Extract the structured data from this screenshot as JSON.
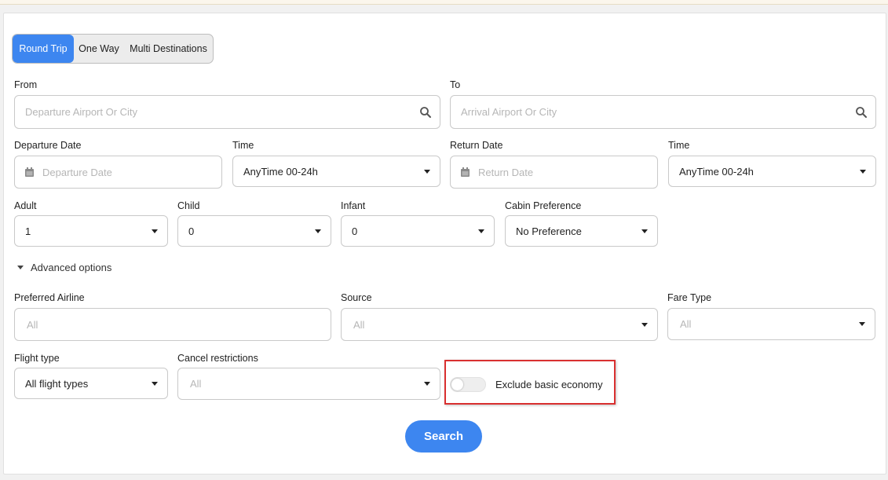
{
  "trip_tabs": [
    "Round Trip",
    "One Way",
    "Multi Destinations"
  ],
  "from": {
    "label": "From",
    "placeholder": "Departure Airport Or City"
  },
  "to": {
    "label": "To",
    "placeholder": "Arrival Airport Or City"
  },
  "departure_date": {
    "label": "Departure Date",
    "placeholder": "Departure Date"
  },
  "departure_time": {
    "label": "Time",
    "value": "AnyTime 00-24h"
  },
  "return_date": {
    "label": "Return Date",
    "placeholder": "Return Date"
  },
  "return_time": {
    "label": "Time",
    "value": "AnyTime 00-24h"
  },
  "adult": {
    "label": "Adult",
    "value": "1"
  },
  "child": {
    "label": "Child",
    "value": "0"
  },
  "infant": {
    "label": "Infant",
    "value": "0"
  },
  "cabin": {
    "label": "Cabin Preference",
    "value": "No Preference"
  },
  "advanced_options": "Advanced options",
  "preferred_airline": {
    "label": "Preferred Airline",
    "placeholder": "All"
  },
  "source": {
    "label": "Source",
    "placeholder": "All"
  },
  "fare_type": {
    "label": "Fare Type",
    "placeholder": "All"
  },
  "flight_type": {
    "label": "Flight type",
    "value": "All flight types"
  },
  "cancel_restrictions": {
    "label": "Cancel restrictions",
    "placeholder": "All"
  },
  "exclude_basic_economy": {
    "label": "Exclude basic economy",
    "on": false
  },
  "search_button": "Search",
  "colors": {
    "accent": "#3d86f0",
    "highlight_box": "#d93030"
  }
}
